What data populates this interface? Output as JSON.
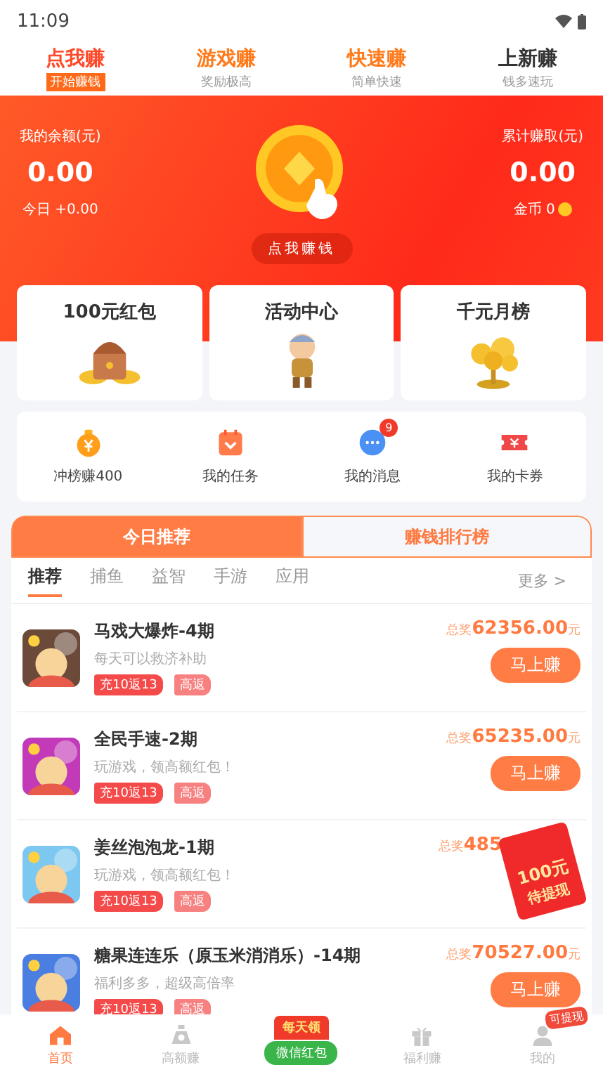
{
  "status_bar": {
    "time": "11:09"
  },
  "top_tabs": [
    {
      "title": "点我赚",
      "subtitle": "开始赚钱",
      "selected": true
    },
    {
      "title": "游戏赚",
      "subtitle": "奖励极高",
      "selected": false
    },
    {
      "title": "快速赚",
      "subtitle": "简单快速",
      "selected": false
    },
    {
      "title": "上新赚",
      "subtitle": "钱多速玩",
      "selected": false
    }
  ],
  "header": {
    "balance_label": "我的余额(元)",
    "balance": "0.00",
    "today": "今日 +0.00",
    "earn_button": "点我赚钱",
    "total_label": "累计赚取(元)",
    "total": "0.00",
    "coins": "金币 0"
  },
  "cards": [
    {
      "title": "100元红包",
      "kind": "chest"
    },
    {
      "title": "活动中心",
      "kind": "figure"
    },
    {
      "title": "千元月榜",
      "kind": "tree"
    }
  ],
  "shortcuts": [
    {
      "label": "冲榜赚400",
      "kind": "bag"
    },
    {
      "label": "我的任务",
      "kind": "task"
    },
    {
      "label": "我的消息",
      "kind": "message",
      "badge": "9"
    },
    {
      "label": "我的卡券",
      "kind": "ticket"
    }
  ],
  "section_tabs": [
    {
      "label": "今日推荐",
      "selected": true
    },
    {
      "label": "赚钱排行榜",
      "selected": false
    }
  ],
  "categories": [
    {
      "label": "推荐",
      "selected": true
    },
    {
      "label": "捕鱼",
      "selected": false
    },
    {
      "label": "益智",
      "selected": false
    },
    {
      "label": "手游",
      "selected": false
    },
    {
      "label": "应用",
      "selected": false
    }
  ],
  "more": "更多 >",
  "games": [
    {
      "title": "马戏大爆炸-4期",
      "desc": "每天可以救济补助",
      "tags": [
        "充10返13",
        "高返"
      ],
      "prize_label": "总奖",
      "prize": "62356.00",
      "unit": "元",
      "action": "马上赚",
      "color": "#6b4a3a"
    },
    {
      "title": "全民手速-2期",
      "desc": "玩游戏，领高额红包！",
      "tags": [
        "充10返13",
        "高返"
      ],
      "prize_label": "总奖",
      "prize": "65235.00",
      "unit": "元",
      "action": "马上赚",
      "color": "#c23ab8"
    },
    {
      "title": "姜丝泡泡龙-1期",
      "desc": "玩游戏，领高额红包！",
      "tags": [
        "充10返13",
        "高返"
      ],
      "prize_label": "总奖",
      "prize": "485",
      "color": "#7cc8f0"
    },
    {
      "title": "糖果连连乐（原玉米消消乐）-14期",
      "desc": "福利多多，超级高倍率",
      "tags": [
        "充10返13",
        "高返"
      ],
      "prize_label": "总奖",
      "prize": "70527.00",
      "unit": "元",
      "action": "马上赚",
      "color": "#4a7ee0"
    }
  ],
  "floating_envelope": {
    "amount": "100元",
    "label": "待提现"
  },
  "bottom_nav": [
    {
      "label": "首页",
      "kind": "home",
      "selected": true
    },
    {
      "label": "高额赚",
      "kind": "bag",
      "selected": false
    },
    {
      "label": "微信红包",
      "kind": "envelope",
      "selected": false,
      "top": "每天领"
    },
    {
      "label": "福利赚",
      "kind": "gift",
      "selected": false
    },
    {
      "label": "我的",
      "kind": "user",
      "selected": false,
      "badge": "可提现"
    }
  ]
}
